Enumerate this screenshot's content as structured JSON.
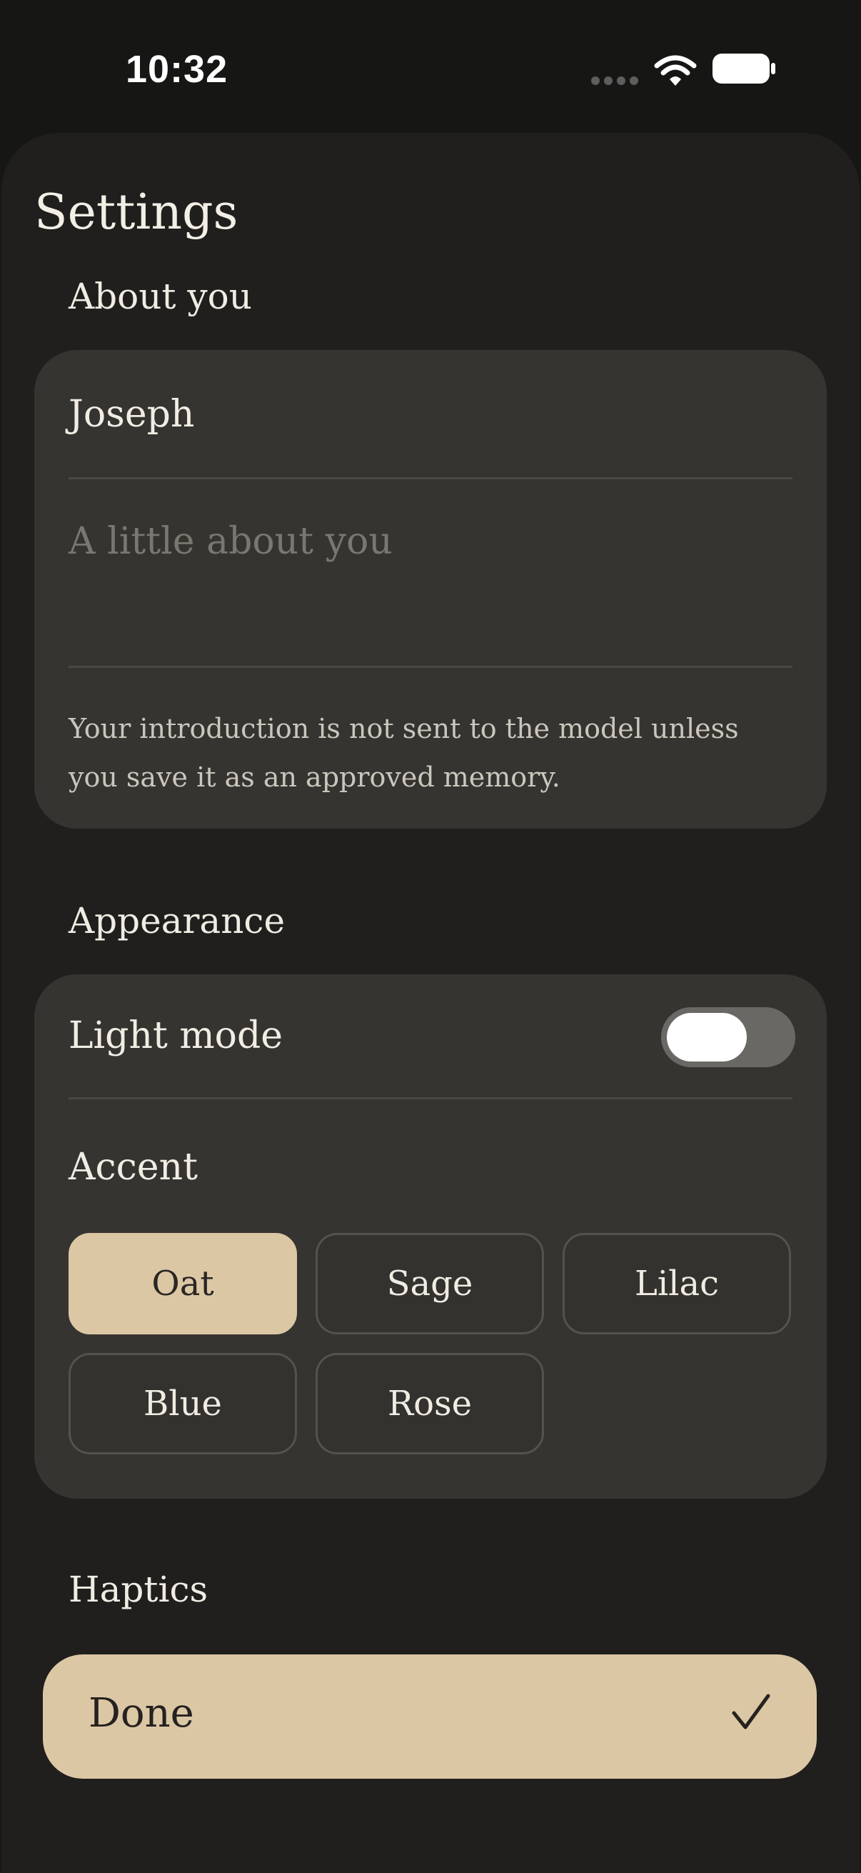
{
  "status_bar": {
    "time": "10:32"
  },
  "page": {
    "title": "Settings"
  },
  "about": {
    "section_label": "About you",
    "name_value": "Joseph",
    "intro_placeholder": "A little about you",
    "note": "Your introduction is not sent to the model unless you save it as an approved memory."
  },
  "appearance": {
    "section_label": "Appearance",
    "light_mode_label": "Light mode",
    "light_mode_on": false,
    "accent_label": "Accent",
    "accents": [
      {
        "label": "Oat",
        "selected": true,
        "color": "#dcc7a5"
      },
      {
        "label": "Sage",
        "selected": false
      },
      {
        "label": "Lilac",
        "selected": false
      },
      {
        "label": "Blue",
        "selected": false
      },
      {
        "label": "Rose",
        "selected": false
      }
    ]
  },
  "haptics": {
    "section_label": "Haptics"
  },
  "done_button": {
    "label": "Done",
    "icon": "check-icon"
  },
  "colors": {
    "background": "#201f1d",
    "card": "#363430",
    "accent": "#dcc7a5"
  }
}
